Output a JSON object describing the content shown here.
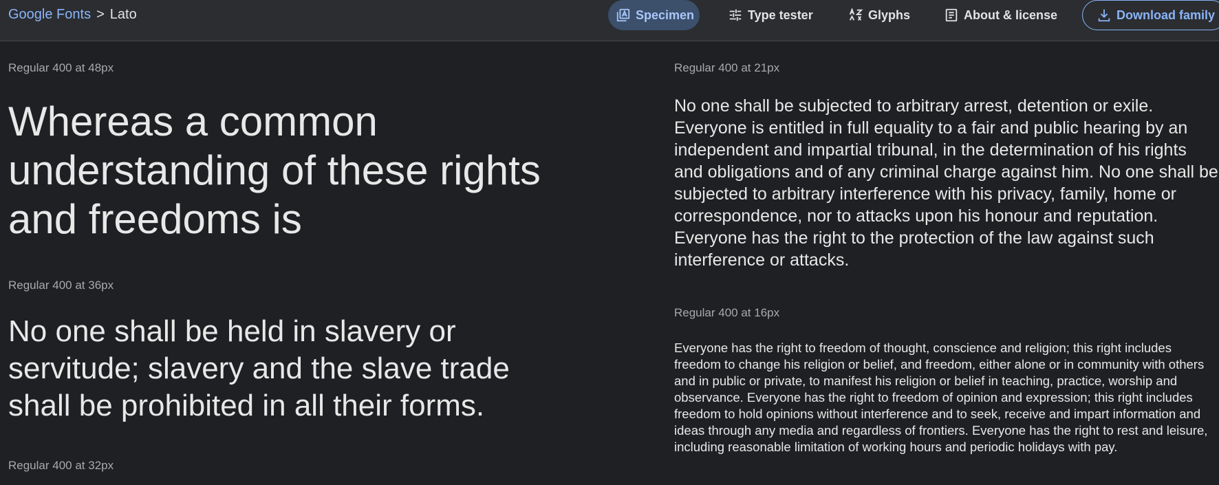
{
  "breadcrumb": {
    "parent": "Google Fonts",
    "separator": ">",
    "current": "Lato"
  },
  "nav": {
    "specimen": "Specimen",
    "type_tester": "Type tester",
    "glyphs": "Glyphs",
    "about": "About & license",
    "download": "Download family"
  },
  "icons": {
    "specimen": "specimen-icon",
    "type_tester": "sliders-icon",
    "glyphs": "glyphs-icon",
    "about": "document-icon",
    "download": "download-icon"
  },
  "colors": {
    "accent": "#8ab4f8",
    "active_tab_bg": "#3c4f6b",
    "background": "#1f2023",
    "topbar": "#2b2d31"
  },
  "samples": [
    {
      "label": "Regular 400 at 48px",
      "text": "Whereas a common understanding of these rights and freedoms is"
    },
    {
      "label": "Regular 400 at 36px",
      "text": "No one shall be held in slavery or servitude; slavery and the slave trade shall be prohibited in all their forms."
    },
    {
      "label": "Regular 400 at 32px",
      "text": ""
    },
    {
      "label": "Regular 400 at 21px",
      "text": "No one shall be subjected to arbitrary arrest, detention or exile. Everyone is entitled in full equality to a fair and public hearing by an independent and impartial tribunal, in the determination of his rights and obligations and of any criminal charge against him. No one shall be subjected to arbitrary interference with his privacy, family, home or correspondence, nor to attacks upon his honour and reputation. Everyone has the right to the protection of the law against such interference or attacks."
    },
    {
      "label": "Regular 400 at 16px",
      "text": "Everyone has the right to freedom of thought, conscience and religion; this right includes freedom to change his religion or belief, and freedom, either alone or in community with others and in public or private, to manifest his religion or belief in teaching, practice, worship and observance. Everyone has the right to freedom of opinion and expression; this right includes freedom to hold opinions without interference and to seek, receive and impart information and ideas through any media and regardless of frontiers. Everyone has the right to rest and leisure, including reasonable limitation of working hours and periodic holidays with pay."
    }
  ]
}
